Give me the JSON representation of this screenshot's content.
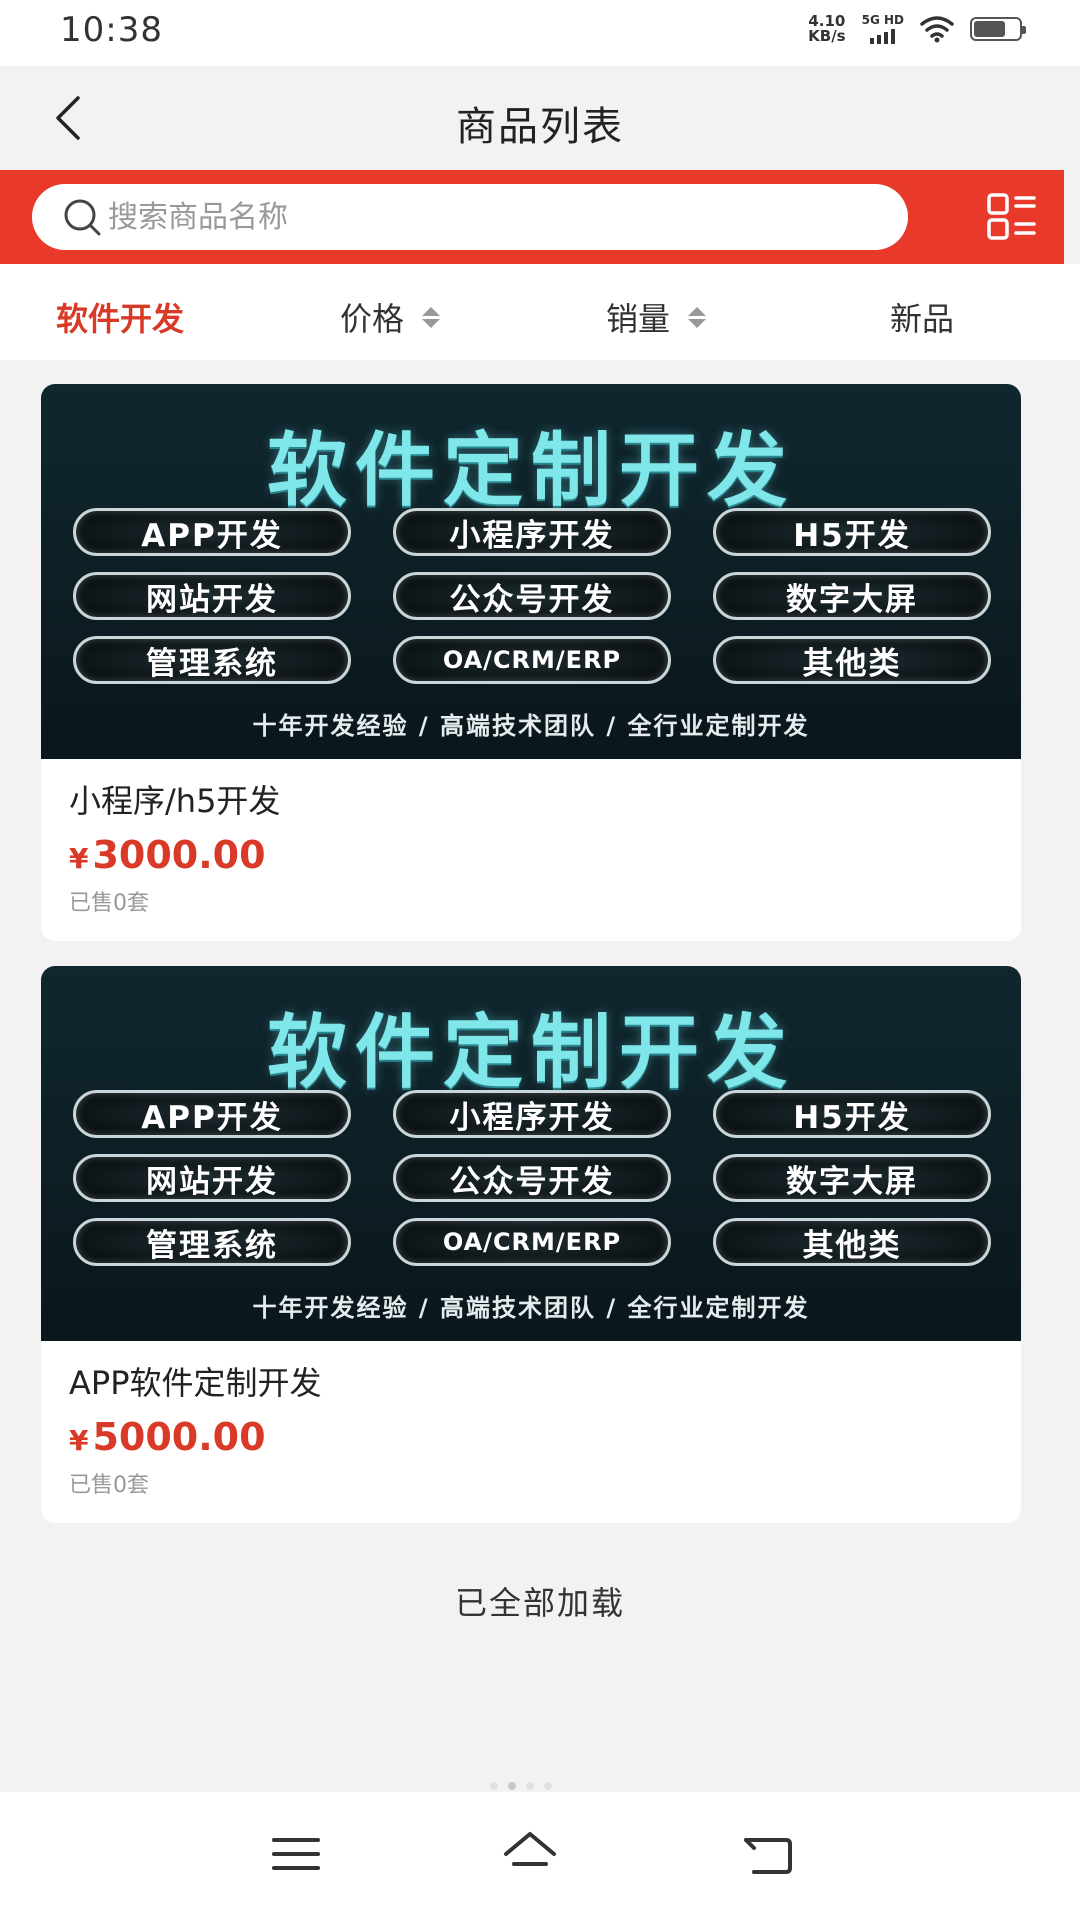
{
  "status_bar": {
    "time": "10:38",
    "net_speed_value": "4.10",
    "net_speed_unit": "KB/s",
    "signal_label": "5G HD",
    "battery_level": 0.7
  },
  "nav": {
    "title": "商品列表"
  },
  "search": {
    "placeholder": "搜索商品名称"
  },
  "filters": {
    "category": "软件开发",
    "price": "价格",
    "sales": "销量",
    "new": "新品"
  },
  "banner": {
    "title": "软件定制开发",
    "pills": [
      "APP开发",
      "小程序开发",
      "H5开发",
      "网站开发",
      "公众号开发",
      "数字大屏",
      "管理系统",
      "OA/CRM/ERP",
      "其他类"
    ],
    "tagline": "十年开发经验 / 高端技术团队 / 全行业定制开发"
  },
  "products": [
    {
      "name": "小程序/h5开发",
      "currency": "¥",
      "price": "3000.00",
      "sold": "已售0套"
    },
    {
      "name": "APP软件定制开发",
      "currency": "¥",
      "price": "5000.00",
      "sold": "已售0套"
    }
  ],
  "footer": {
    "load_status": "已全部加载"
  },
  "colors": {
    "accent": "#e8392b",
    "price": "#d93a27",
    "banner_title": "#7fe6ea"
  },
  "icons": [
    "back-arrow-icon",
    "search-icon",
    "layout-toggle-icon",
    "sort-icon",
    "menu-icon",
    "home-icon",
    "back-icon"
  ]
}
